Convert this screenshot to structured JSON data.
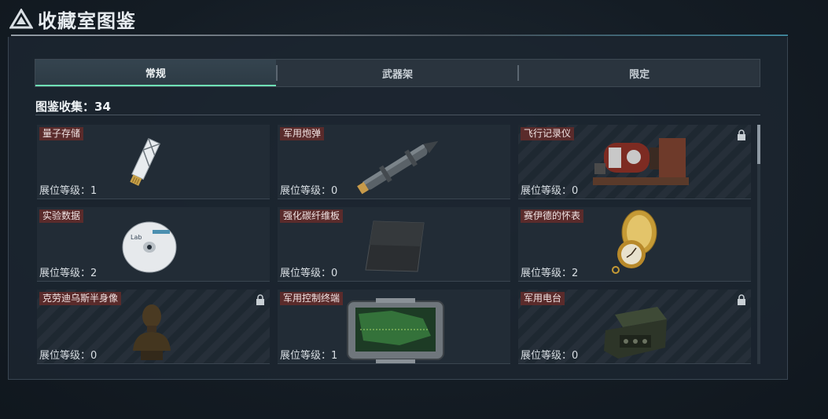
{
  "header": {
    "title": "收藏室图鉴",
    "logo_icon": "triangle-logo-icon"
  },
  "tabs": [
    {
      "label": "常规",
      "active": true
    },
    {
      "label": "武器架",
      "active": false
    },
    {
      "label": "限定",
      "active": false
    }
  ],
  "collection": {
    "label": "图鉴收集：",
    "count": "34"
  },
  "items": [
    {
      "name": "量子存储",
      "level": "展位等级：1",
      "locked": false,
      "icon": "usb-drive-icon"
    },
    {
      "name": "军用炮弹",
      "level": "展位等级：0",
      "locked": false,
      "icon": "artillery-shell-icon"
    },
    {
      "name": "飞行记录仪",
      "level": "展位等级：0",
      "locked": true,
      "icon": "flight-recorder-icon"
    },
    {
      "name": "实验数据",
      "level": "展位等级：2",
      "locked": false,
      "icon": "data-disc-icon"
    },
    {
      "name": "强化碳纤维板",
      "level": "展位等级：0",
      "locked": false,
      "icon": "carbon-fiber-plate-icon"
    },
    {
      "name": "赛伊德的怀表",
      "level": "展位等级：2",
      "locked": false,
      "icon": "pocket-watch-icon"
    },
    {
      "name": "克劳迪乌斯半身像",
      "level": "展位等级：0",
      "locked": true,
      "icon": "bust-statue-icon"
    },
    {
      "name": "军用控制终端",
      "level": "展位等级：1",
      "locked": false,
      "icon": "control-terminal-icon"
    },
    {
      "name": "军用电台",
      "level": "展位等级：0",
      "locked": true,
      "icon": "military-radio-icon"
    }
  ],
  "colors": {
    "accent": "#6fe0b5",
    "name_tag": "#5a2b2b"
  },
  "scroll": {
    "position": 0
  }
}
